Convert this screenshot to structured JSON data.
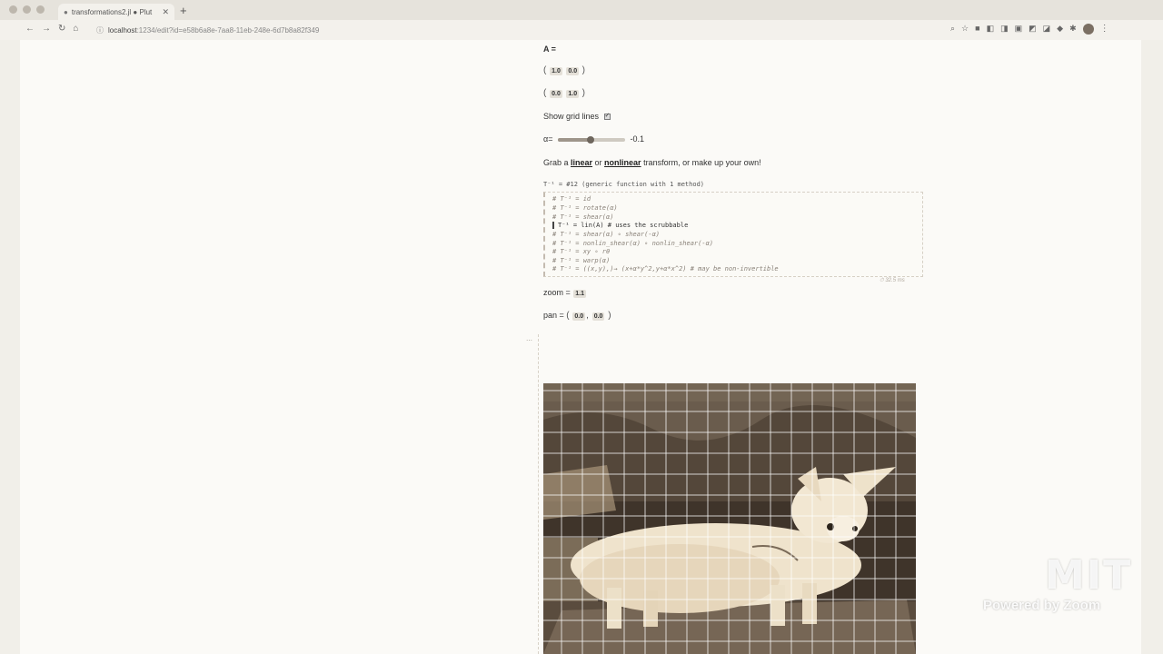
{
  "browser": {
    "tab_title": "transformations2.jl",
    "tab_subtitle": "Plut",
    "url_host": "localhost",
    "url_rest": ":1234/edit?id=e58b6a8e-7aa8-11eb-248e-6d7b8a82f349"
  },
  "notebook": {
    "matrix_label": "A =",
    "matrix_rows": [
      [
        "1.0",
        "0.0"
      ],
      [
        "0.0",
        "1.0"
      ]
    ],
    "show_grid_label": "Show grid lines",
    "alpha_label": "α=",
    "alpha_value": "-0.1",
    "alpha_fraction": 0.48,
    "grab_prefix": "Grab a ",
    "grab_linear": "linear",
    "grab_or": " or ",
    "grab_nonlinear": "nonlinear",
    "grab_suffix": " transform, or make up your own!",
    "cell_output": "T⁻¹ = #12 (generic function with 1 method)",
    "code_lines": [
      "#   T⁻¹ = id",
      "#   T⁻¹ = rotate(α)",
      "#   T⁻¹ = shear(α)",
      "T⁻¹ = lin(A) # uses the scrubbable",
      "#   T⁻¹ = shear(α) ∘ shear(-α)",
      "#   T⁻¹ = nonlin_shear(α)  ∘ nonlin_shear(-α)",
      "#   T⁻¹ =  xy  ∘ rθ",
      "#   T⁻¹ = warp(α)",
      "#   T⁻¹ = ((x,y),)→ (x+α*y^2,y+α*x^2) # may be non-invertible"
    ],
    "runtime": "⏱ 32.5 ms",
    "zoom_label": "zoom = ",
    "zoom_value": "1.1",
    "pan_label": "pan = ",
    "pan_values": [
      "0.0",
      "0.0"
    ]
  },
  "watermark": {
    "logo_text": "MIT",
    "powered_text": "Powered by Zoom"
  },
  "colors": {
    "sepia_light": "#e9dcc3",
    "sepia_dark": "#4a3d30",
    "grid_line": "#ffffff"
  }
}
